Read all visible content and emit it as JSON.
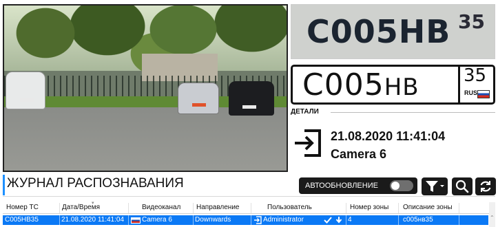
{
  "plate_crop": {
    "text": "С005НВ",
    "region": "35"
  },
  "plate": {
    "series1": "С",
    "digits": "005",
    "series2": "НВ",
    "region": "35",
    "country": "RUS"
  },
  "details": {
    "label": "ДЕТАЛИ",
    "datetime": "21.08.2020 11:41:04",
    "camera": "Camera 6"
  },
  "journal": {
    "title": "ЖУРНАЛ РАСПОЗНАВАНИЯ",
    "auto_refresh_label": "АВТООБНОВЛЕНИЕ",
    "auto_refresh_on": false
  },
  "table": {
    "headers": {
      "plate": "Номер ТС",
      "datetime": "Дата/Время",
      "channel": "Видеоканал",
      "direction": "Направление",
      "user": "Пользователь",
      "zone_num": "Номер зоны",
      "zone_desc": "Описание зоны"
    },
    "rows": [
      {
        "plate": "С005НВ35",
        "datetime": "21.08.2020 11:41:04",
        "channel": "Camera 6",
        "direction": "Downwards",
        "user": "Administrator",
        "zone_num": "4",
        "zone_desc": "с005нв35"
      }
    ]
  },
  "colors": {
    "accent": "#0b79f5",
    "dark_button": "#1a1a1a"
  }
}
